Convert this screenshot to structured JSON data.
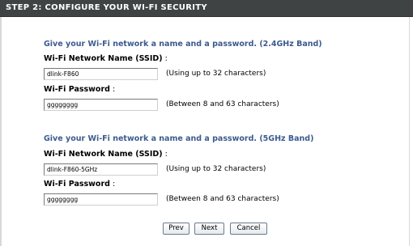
{
  "header": {
    "title": "STEP 2: CONFIGURE YOUR WI-FI SECURITY"
  },
  "band_24": {
    "heading": "Give your Wi-Fi network a name and a password. (2.4GHz Band)",
    "ssid_label": "Wi-Fi Network Name (SSID)",
    "ssid_value": "dlink-F860",
    "ssid_hint": "(Using up to 32 characters)",
    "password_label": "Wi-Fi Password",
    "password_value": "gggggggg",
    "password_hint": "(Between 8 and 63 characters)"
  },
  "band_5": {
    "heading": "Give your Wi-Fi network a name and a password. (5GHz Band)",
    "ssid_label": "Wi-Fi Network Name (SSID)",
    "ssid_value": "dlink-F860-5GHz",
    "ssid_hint": "(Using up to 32 characters)",
    "password_label": "Wi-Fi Password",
    "password_value": "gggggggg",
    "password_hint": "(Between 8 and 63 characters)"
  },
  "buttons": {
    "prev": "Prev",
    "next": "Next",
    "cancel": "Cancel"
  },
  "colors": {
    "header_bg": "#404343",
    "heading_text": "#3c5a8f"
  }
}
